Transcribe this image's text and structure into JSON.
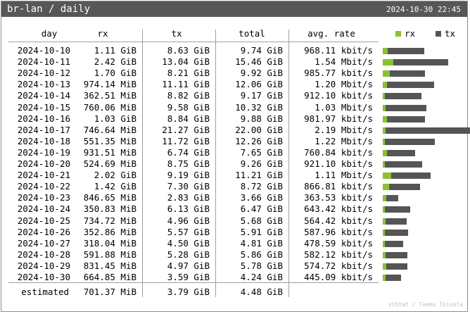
{
  "title": "br-lan / daily",
  "generated": "2024-10-30 22:45",
  "headers": {
    "day": "day",
    "rx": "rx",
    "tx": "tx",
    "total": "total",
    "rate": "avg. rate"
  },
  "legend": {
    "rx": "rx",
    "tx": "tx",
    "rx_color": "#8ac233",
    "tx_color": "#555555"
  },
  "rows": [
    {
      "day": "2024-10-10",
      "rx": "1.11 GiB",
      "tx": "8.63 GiB",
      "total": "9.74 GiB",
      "rate": "968.11 kbit/s",
      "rx_gib": 1.11,
      "tx_gib": 8.63
    },
    {
      "day": "2024-10-11",
      "rx": "2.42 GiB",
      "tx": "13.04 GiB",
      "total": "15.46 GiB",
      "rate": "1.54 Mbit/s",
      "rx_gib": 2.42,
      "tx_gib": 13.04
    },
    {
      "day": "2024-10-12",
      "rx": "1.70 GiB",
      "tx": "8.21 GiB",
      "total": "9.92 GiB",
      "rate": "985.77 kbit/s",
      "rx_gib": 1.7,
      "tx_gib": 8.21
    },
    {
      "day": "2024-10-13",
      "rx": "974.14 MiB",
      "tx": "11.11 GiB",
      "total": "12.06 GiB",
      "rate": "1.20 Mbit/s",
      "rx_gib": 0.95,
      "tx_gib": 11.11
    },
    {
      "day": "2024-10-14",
      "rx": "362.51 MiB",
      "tx": "8.82 GiB",
      "total": "9.17 GiB",
      "rate": "912.10 kbit/s",
      "rx_gib": 0.35,
      "tx_gib": 8.82
    },
    {
      "day": "2024-10-15",
      "rx": "760.06 MiB",
      "tx": "9.58 GiB",
      "total": "10.32 GiB",
      "rate": "1.03 Mbit/s",
      "rx_gib": 0.74,
      "tx_gib": 9.58
    },
    {
      "day": "2024-10-16",
      "rx": "1.03 GiB",
      "tx": "8.84 GiB",
      "total": "9.88 GiB",
      "rate": "981.97 kbit/s",
      "rx_gib": 1.03,
      "tx_gib": 8.84
    },
    {
      "day": "2024-10-17",
      "rx": "746.64 MiB",
      "tx": "21.27 GiB",
      "total": "22.00 GiB",
      "rate": "2.19 Mbit/s",
      "rx_gib": 0.73,
      "tx_gib": 21.27
    },
    {
      "day": "2024-10-18",
      "rx": "551.35 MiB",
      "tx": "11.72 GiB",
      "total": "12.26 GiB",
      "rate": "1.22 Mbit/s",
      "rx_gib": 0.54,
      "tx_gib": 11.72
    },
    {
      "day": "2024-10-19",
      "rx": "931.51 MiB",
      "tx": "6.74 GiB",
      "total": "7.65 GiB",
      "rate": "760.84 kbit/s",
      "rx_gib": 0.91,
      "tx_gib": 6.74
    },
    {
      "day": "2024-10-20",
      "rx": "524.69 MiB",
      "tx": "8.75 GiB",
      "total": "9.26 GiB",
      "rate": "921.10 kbit/s",
      "rx_gib": 0.51,
      "tx_gib": 8.75
    },
    {
      "day": "2024-10-21",
      "rx": "2.02 GiB",
      "tx": "9.19 GiB",
      "total": "11.21 GiB",
      "rate": "1.11 Mbit/s",
      "rx_gib": 2.02,
      "tx_gib": 9.19
    },
    {
      "day": "2024-10-22",
      "rx": "1.42 GiB",
      "tx": "7.30 GiB",
      "total": "8.72 GiB",
      "rate": "866.81 kbit/s",
      "rx_gib": 1.42,
      "tx_gib": 7.3
    },
    {
      "day": "2024-10-23",
      "rx": "846.65 MiB",
      "tx": "2.83 GiB",
      "total": "3.66 GiB",
      "rate": "363.53 kbit/s",
      "rx_gib": 0.83,
      "tx_gib": 2.83
    },
    {
      "day": "2024-10-24",
      "rx": "350.83 MiB",
      "tx": "6.13 GiB",
      "total": "6.47 GiB",
      "rate": "643.42 kbit/s",
      "rx_gib": 0.34,
      "tx_gib": 6.13
    },
    {
      "day": "2024-10-25",
      "rx": "734.72 MiB",
      "tx": "4.96 GiB",
      "total": "5.68 GiB",
      "rate": "564.42 kbit/s",
      "rx_gib": 0.72,
      "tx_gib": 4.96
    },
    {
      "day": "2024-10-26",
      "rx": "352.86 MiB",
      "tx": "5.57 GiB",
      "total": "5.91 GiB",
      "rate": "587.96 kbit/s",
      "rx_gib": 0.34,
      "tx_gib": 5.57
    },
    {
      "day": "2024-10-27",
      "rx": "318.04 MiB",
      "tx": "4.50 GiB",
      "total": "4.81 GiB",
      "rate": "478.59 kbit/s",
      "rx_gib": 0.31,
      "tx_gib": 4.5
    },
    {
      "day": "2024-10-28",
      "rx": "591.88 MiB",
      "tx": "5.28 GiB",
      "total": "5.86 GiB",
      "rate": "582.12 kbit/s",
      "rx_gib": 0.58,
      "tx_gib": 5.28
    },
    {
      "day": "2024-10-29",
      "rx": "831.45 MiB",
      "tx": "4.97 GiB",
      "total": "5.78 GiB",
      "rate": "574.72 kbit/s",
      "rx_gib": 0.81,
      "tx_gib": 4.97
    },
    {
      "day": "2024-10-30",
      "rx": "664.85 MiB",
      "tx": "3.59 GiB",
      "total": "4.24 GiB",
      "rate": "445.09 kbit/s",
      "rx_gib": 0.65,
      "tx_gib": 3.59
    }
  ],
  "estimated": {
    "label": "estimated",
    "rx": "701.37 MiB",
    "tx": "3.79 GiB",
    "total": "4.48 GiB"
  },
  "footer": "vnStat / Teemu Toivola"
}
